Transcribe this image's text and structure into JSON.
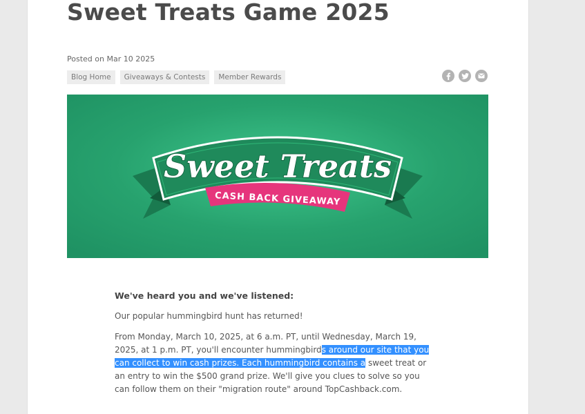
{
  "article": {
    "title": "Sweet Treats Game 2025",
    "posted": "Posted on Mar 10 2025",
    "tags": [
      "Blog Home",
      "Giveaways & Contests",
      "Member Rewards"
    ],
    "share_icons": [
      "facebook-icon",
      "twitter-icon",
      "email-icon"
    ]
  },
  "banner": {
    "title": "Sweet Treats",
    "subtitle": "CASH BACK GIVEAWAY",
    "colors": {
      "background": "#27a26e",
      "ribbon": "#1d7f55",
      "subtitle_bg": "#e6357c"
    }
  },
  "body": {
    "heading": "We've heard you and we've listened:",
    "paragraph1": "Our popular hummingbird hunt has returned!",
    "paragraph2_before": "From Monday, March 10, 2025, at 6 a.m. PT, until Wednesday, March 19, 2025, at 1 p.m. PT, you'll encounter hummingbird",
    "paragraph2_selected": "s around our site that you can collect to win cash prizes. Each hummingbird contains a",
    "paragraph2_after": " sweet treat or an entry to win the $500 grand prize. We'll give you clues to solve so you can follow them on their \"migration route\" around TopCashback.com.",
    "selection_color": "#3390ff"
  }
}
